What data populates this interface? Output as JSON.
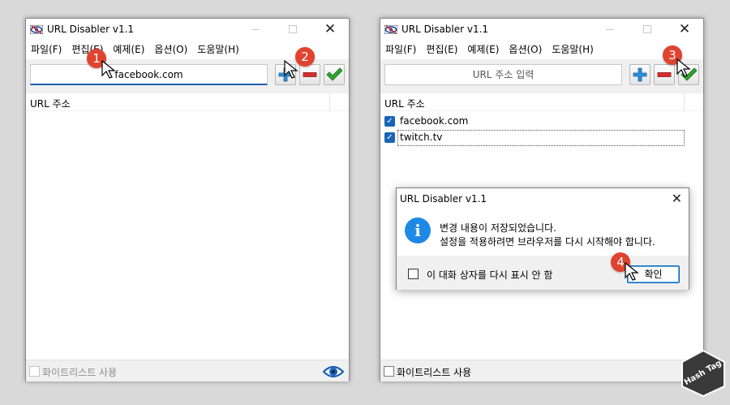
{
  "left_window": {
    "title": "URL Disabler v1.1",
    "menu": [
      "파일(F)",
      "편집(E)",
      "예제(E)",
      "옵션(O)",
      "도움말(H)"
    ],
    "url_input_value": "facebook.com",
    "list_header": "URL 주소",
    "whitelist_label": "화이트리스트 사용",
    "whitelist_checked": false,
    "whitelist_enabled": false
  },
  "right_window": {
    "title": "URL Disabler v1.1",
    "menu": [
      "파일(F)",
      "편집(E)",
      "예제(E)",
      "옵션(O)",
      "도움말(H)"
    ],
    "url_input_placeholder": "URL 주소 입력",
    "list_header": "URL 주소",
    "items": [
      {
        "label": "facebook.com",
        "checked": true
      },
      {
        "label": "twitch.tv",
        "checked": true
      }
    ],
    "whitelist_label": "화이트리스트 사용",
    "whitelist_checked": false
  },
  "dialog": {
    "title": "URL Disabler v1.1",
    "message_line1": "변경 내용이 저장되었습니다.",
    "message_line2": "설정을 적용하려면 브라우저를 다시 시작해야 합니다.",
    "dont_show_label": "이 대화 상자를 다시 표시 안 함",
    "ok_label": "확인"
  },
  "step_badges": [
    "1",
    "2",
    "3",
    "4"
  ],
  "watermark": "Hash Tag",
  "icons": {
    "app": "url-disabler-eye-icon",
    "add": "plus-icon",
    "remove": "minus-icon",
    "apply": "checkmark-icon",
    "info": "info-icon",
    "status": "eye-icon"
  },
  "colors": {
    "accent_blue": "#1a64b6",
    "badge_red": "#e0432f",
    "add_blue": "#2e8fd6",
    "remove_red": "#d62b2b",
    "apply_green": "#2ea42e"
  }
}
